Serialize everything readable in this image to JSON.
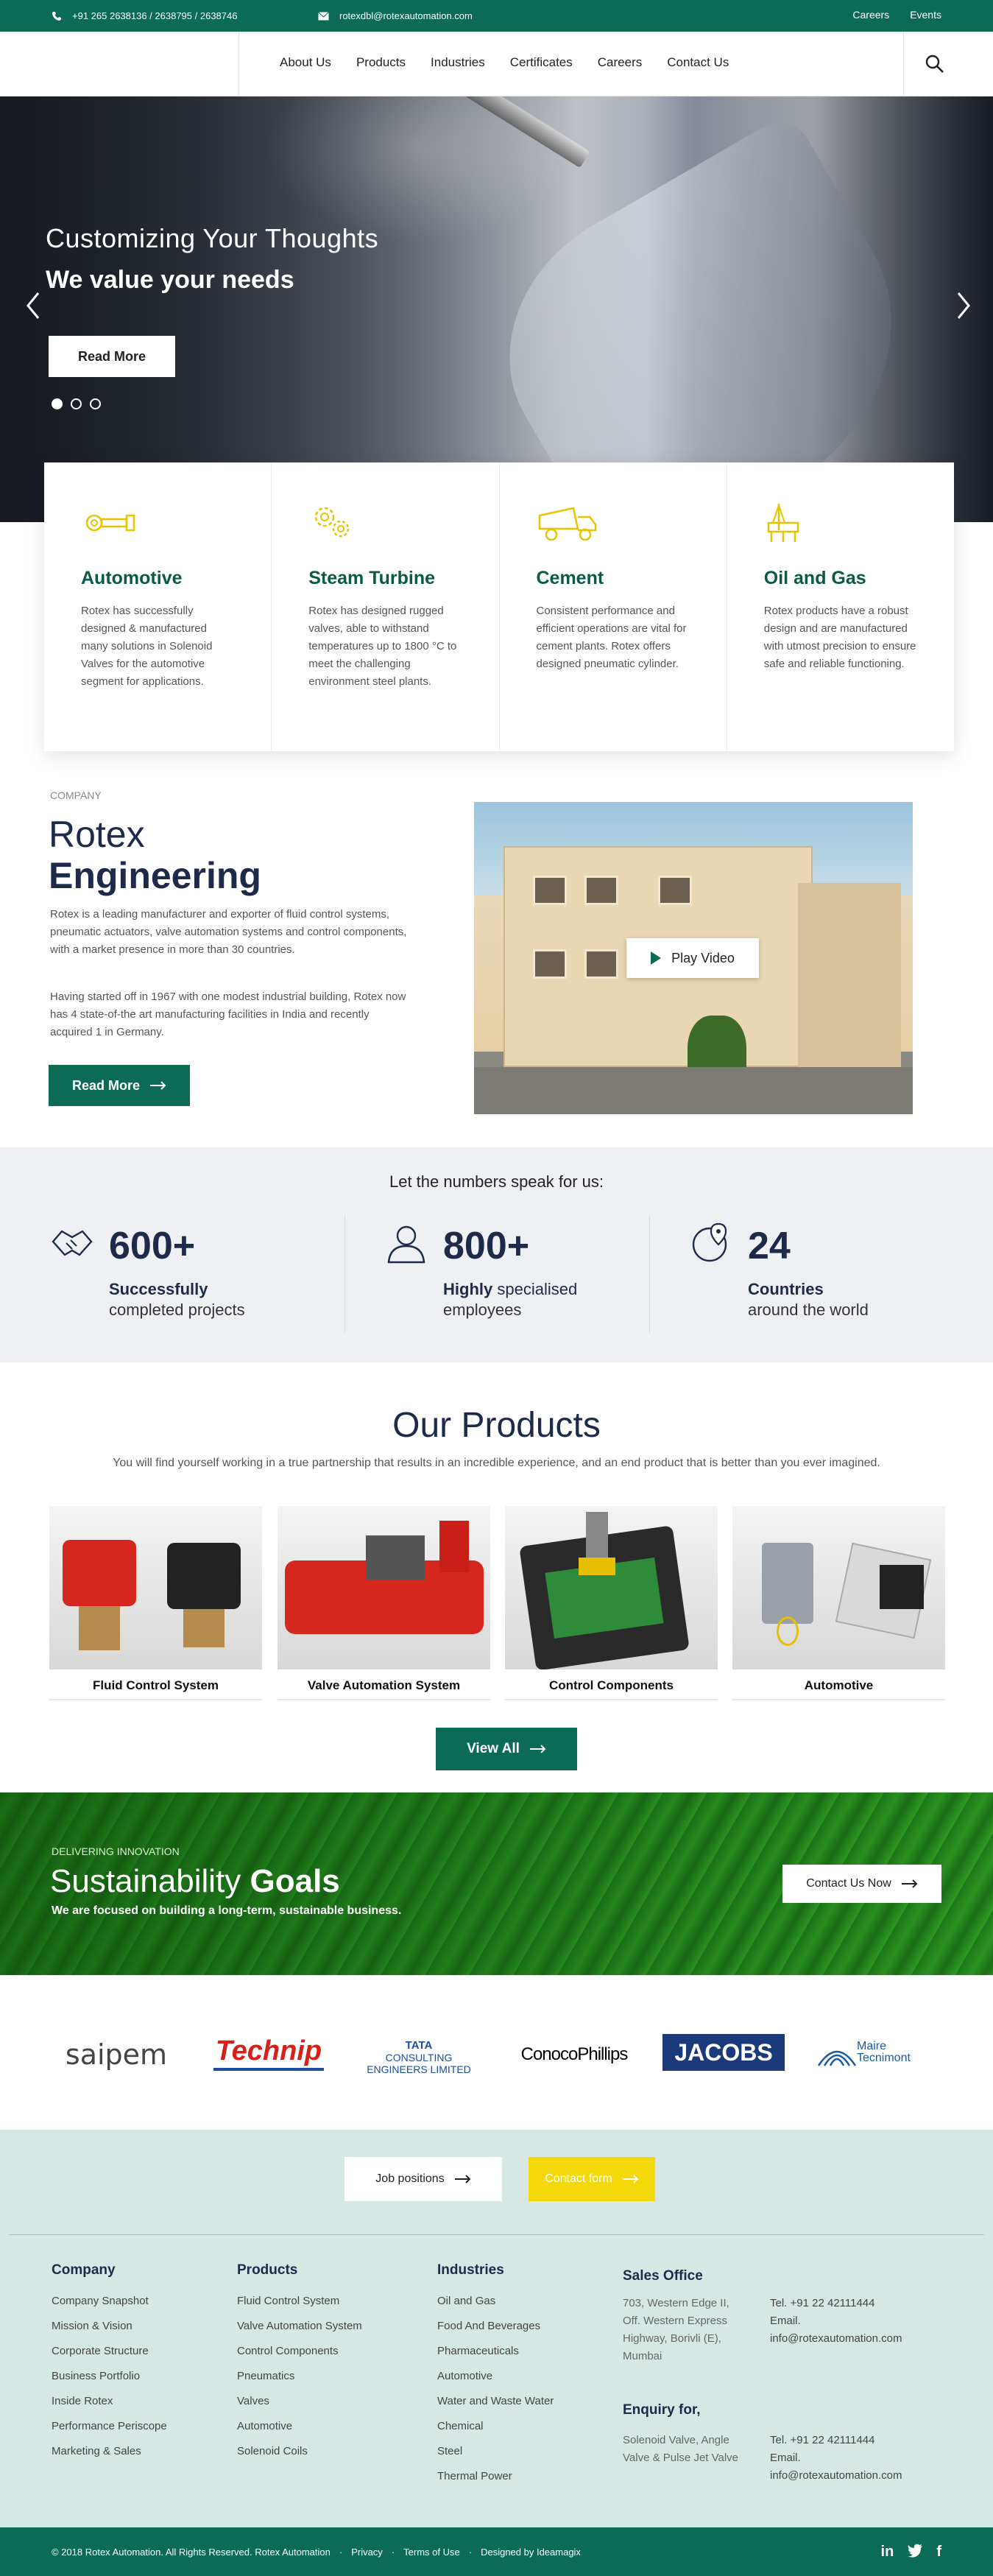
{
  "topbar": {
    "phone": "+91 265 2638136 / 2638795 / 2638746",
    "email": "rotexdbl@rotexautomation.com",
    "links": [
      "Careers",
      "Events"
    ]
  },
  "nav": {
    "items": [
      "About Us",
      "Products",
      "Industries",
      "Certificates",
      "Careers",
      "Contact Us"
    ]
  },
  "hero": {
    "subtitle": "Customizing Your Thoughts",
    "title": "We value your needs",
    "button": "Read More"
  },
  "industries": [
    {
      "title": "Automotive",
      "text": "Rotex has successfully designed & manufactured many solutions in Solenoid Valves for the automotive segment for applications.",
      "icon": "car-parts-icon"
    },
    {
      "title": "Steam Turbine",
      "text": "Rotex has designed rugged valves, able to withstand temperatures up to 1800 °C to meet the challenging environment steel plants.",
      "icon": "gears-icon"
    },
    {
      "title": "Cement",
      "text": "Consistent performance and efficient operations are vital for cement plants. Rotex offers designed pneumatic cylinder.",
      "icon": "dump-truck-icon"
    },
    {
      "title": "Oil and Gas",
      "text": "Rotex products have a robust design and are manufactured with utmost precision to ensure safe and reliable functioning.",
      "icon": "oil-rig-icon"
    }
  ],
  "about": {
    "eyebrow": "COMPANY",
    "title_light": "Rotex",
    "title_bold": "Engineering",
    "p1": "Rotex is a leading manufacturer and exporter of fluid control systems, pneumatic actuators, valve automation systems and control components, with a market presence in more than 30 countries.",
    "p2": "Having started off in 1967 with one modest industrial building, Rotex now has 4 state-of-the art manufacturing facilities in India and recently acquired 1 in Germany.",
    "button": "Read More",
    "play": "Play Video"
  },
  "stats": {
    "heading": "Let the numbers speak for us:",
    "items": [
      {
        "num": "600+",
        "bold": "Successfully",
        "rest": "",
        "line2": "completed projects",
        "icon": "handshake-icon"
      },
      {
        "num": "800+",
        "bold": "Highly",
        "rest": " specialised",
        "line2": "employees",
        "icon": "user-icon"
      },
      {
        "num": "24",
        "bold": "Countries",
        "rest": "",
        "line2": "around the world",
        "icon": "globe-pin-icon"
      }
    ]
  },
  "products": {
    "title": "Our Products",
    "subtitle": "You will find yourself working in a true partnership that results in an incredible experience, and an end product that is better than you ever imagined.",
    "items": [
      "Fluid  Control System",
      "Valve Automation System",
      "Control Components",
      "Automotive"
    ],
    "button": "View All"
  },
  "sustainability": {
    "eyebrow": "DELIVERING INNOVATION",
    "title_light": "Sustainability",
    "title_bold": "Goals",
    "desc": "We are focused on building a long-term, sustainable business.",
    "button": "Contact Us Now"
  },
  "clients": [
    "saipem",
    "Technip",
    "TATA",
    "CONSULTING",
    "ENGINEERS LIMITED",
    "ConocoPhillips",
    "JACOBS",
    "Maire",
    "Tecnimont"
  ],
  "footer": {
    "job_button": "Job positions",
    "contact_button": "Contact form",
    "company": {
      "title": "Company",
      "items": [
        "Company Snapshot",
        "Mission & Vision",
        "Corporate Structure",
        "Business Portfolio",
        "Inside Rotex",
        "Performance Periscope",
        "Marketing & Sales"
      ]
    },
    "products": {
      "title": "Products",
      "items": [
        "Fluid Control System",
        "Valve Automation System",
        "Control Components",
        "Pneumatics",
        "Valves",
        "Automotive",
        "Solenoid Coils"
      ]
    },
    "industries": {
      "title": "Industries",
      "items": [
        "Oil and Gas",
        "Food And Beverages",
        "Pharmaceuticals",
        "Automotive",
        "Water and Waste Water",
        "Chemical",
        "Steel",
        "Thermal Power"
      ]
    },
    "sales": {
      "title": "Sales Office",
      "address": "703, Western Edge II, Off. Western Express Highway, Borivli (E), Mumbai",
      "tel": "Tel. +91 22 42111444",
      "email_label": "Email.",
      "email": "info@rotexautomation.com"
    },
    "enquiry": {
      "title": "Enquiry for,",
      "address": "Solenoid Valve, Angle Valve & Pulse Jet Valve",
      "tel": "Tel. +91 22 42111444",
      "email_label": "Email.",
      "email": "info@rotexautomation.com"
    }
  },
  "bottom": {
    "copyright": "© 2018 Rotex Automation. All Rights Reserved. Rotex Automation",
    "privacy": "Privacy",
    "terms": "Terms of Use",
    "designed": "Designed by Ideamagix",
    "social": [
      "in",
      "twitter",
      "f"
    ]
  },
  "colors": {
    "brand": "#0b6b55",
    "navy": "#1e2a4a",
    "yellow": "#f5d80a",
    "icon": "#e8c400"
  }
}
